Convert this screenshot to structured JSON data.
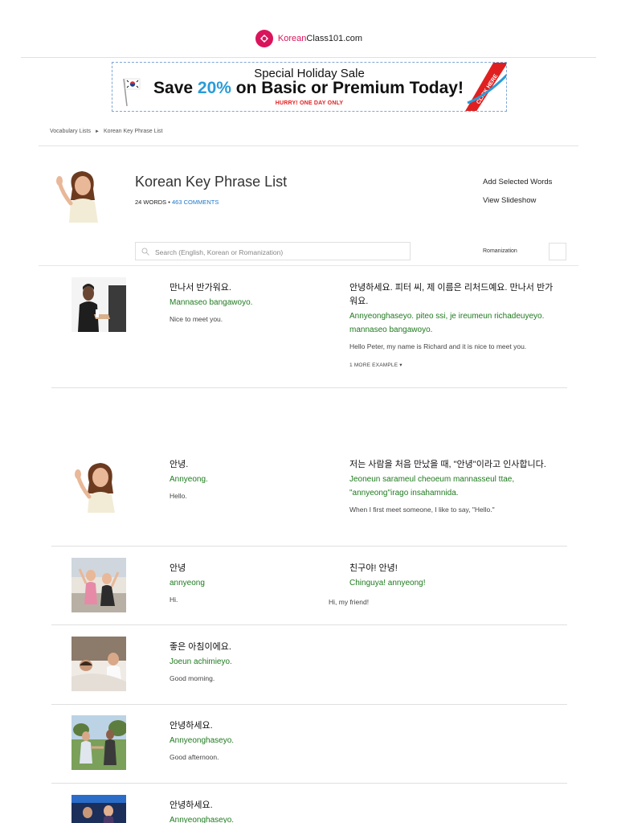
{
  "logo": {
    "brand": "Korean",
    "rest": "Class101.com"
  },
  "banner": {
    "line1": "Special Holiday Sale",
    "line2_pre": "Save ",
    "line2_pct": "20%",
    "line2_post": " on Basic or Premium Today!",
    "line3": "HURRY! ONE DAY ONLY",
    "ribbon": "CLICK HERE"
  },
  "breadcrumb": {
    "item1": "Vocabulary Lists",
    "separator": "►",
    "item2": "Korean Key Phrase List"
  },
  "header": {
    "title": "Korean Key Phrase List",
    "words": "24 WORDS",
    "dot": " • ",
    "comments": "463 COMMENTS",
    "add_selected": "Add Selected Words",
    "view_slideshow": "View Slideshow"
  },
  "search": {
    "placeholder": "Search (English, Korean or Romanization)",
    "romanization_label": "Romanization"
  },
  "entries": [
    {
      "kr": "만나서 반가워요.",
      "rom": "Mannaseo bangawoyo.",
      "en": "Nice to meet you.",
      "ex_kr": "안녕하세요. 피터 씨, 제 이름은 리처드예요. 만나서 반가워요.",
      "ex_rom": "Annyeonghaseyo. piteo ssi, je ireumeun richadeuyeyo. mannaseo bangawoyo.",
      "ex_en": "Hello Peter, my name is Richard and it is nice to meet you.",
      "more": "1 MORE EXAMPLE  ▾"
    },
    {
      "kr": "안녕.",
      "rom": "Annyeong.",
      "en": "Hello.",
      "ex_kr": "저는 사람을 처음 만났을 때, \"안녕\"이라고 인사합니다.",
      "ex_rom": "Jeoneun sarameul cheoeum mannasseul ttae, \"annyeong\"irago insahamnida.",
      "ex_en": "When I first meet someone, I like to say, \"Hello.\""
    },
    {
      "kr": "안녕",
      "rom": "annyeong",
      "en": "Hi.",
      "ex_kr": "친구야! 안녕!",
      "ex_rom": "Chinguya! annyeong!",
      "ex_en": "Hi, my friend!"
    },
    {
      "kr": "좋은 아침이에요.",
      "rom": "Joeun achimieyo.",
      "en": "Good morning."
    },
    {
      "kr": "안녕하세요.",
      "rom": "Annyeonghaseyo.",
      "en": "Good afternoon."
    },
    {
      "kr": "안녕하세요.",
      "rom": "Annyeonghaseyo."
    }
  ],
  "colors": {
    "brand": "#d9145b",
    "accent_blue": "#2a9bd8",
    "romanization_green": "#1f7a1f",
    "link_blue": "#1e78c8",
    "sale_red": "#e02020"
  }
}
